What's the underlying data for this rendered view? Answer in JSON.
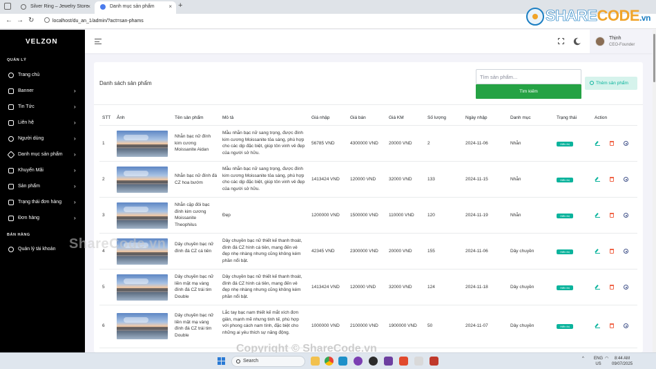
{
  "browser": {
    "tabs": [
      {
        "title": "Silver Ring – Jewelry Store"
      },
      {
        "title": "Danh mục sản phẩm"
      }
    ],
    "url": "localhost/du_an_1/admin/?act=san-phams"
  },
  "watermark": {
    "logo_share": "SHARE",
    "logo_code": "CODE",
    "logo_vn": ".vn",
    "mid_text": "ShareCode.vn",
    "bottom_text": "Copyright © ShareCode.vn"
  },
  "sidebar": {
    "brand": "VELZON",
    "section_admin": "QUẢN LÝ",
    "section_sales": "BÁN HÀNG",
    "items": [
      {
        "label": "Trang chủ",
        "icon": "dashboard-icon",
        "arrow": ""
      },
      {
        "label": "Banner",
        "icon": "image-icon",
        "arrow": "›"
      },
      {
        "label": "Tin Tức",
        "icon": "news-icon",
        "arrow": "›"
      },
      {
        "label": "Liên hệ",
        "icon": "contact-icon",
        "arrow": "›"
      },
      {
        "label": "Người dùng",
        "icon": "user-icon",
        "arrow": "›"
      },
      {
        "label": "Danh mục sản phẩm",
        "icon": "category-icon",
        "arrow": "›"
      },
      {
        "label": "Khuyến Mãi",
        "icon": "promo-icon",
        "arrow": "›"
      },
      {
        "label": "Sản phẩm",
        "icon": "product-icon",
        "arrow": "›"
      },
      {
        "label": "Trạng thái đơn hàng",
        "icon": "cart-icon",
        "arrow": "›"
      },
      {
        "label": "Đơn hàng",
        "icon": "bag-icon",
        "arrow": "›"
      }
    ],
    "sales_items": [
      {
        "label": "Quản lý tài khoản",
        "icon": "account-icon"
      }
    ]
  },
  "topbar": {
    "user_name": "Thịnh",
    "user_role": "CEO-Founder"
  },
  "card": {
    "title": "Danh sách sản phẩm",
    "search_placeholder": "Tìm sản phẩm...",
    "search_button": "Tìm kiếm",
    "add_button": "Thêm sản phẩm"
  },
  "table": {
    "headers": [
      "STT",
      "Ảnh",
      "Tên sản phẩm",
      "Mô tả",
      "Giá nhập",
      "Giá bán",
      "Giá KM",
      "Số lượng",
      "Ngày nhập",
      "Danh mục",
      "Trạng thái",
      "Action"
    ],
    "rows": [
      {
        "stt": "1",
        "name": "Nhẫn bạc nữ đính kim cương Moissanite Aidan",
        "desc": "Mẫu nhẫn bạc nữ sang trọng, được đính kim cương Moissanite tỏa sáng, phù hợp cho các dịp đặc biệt, giúp tôn vinh vẻ đẹp của người sở hữu.",
        "import_price": "56785 VND",
        "sale_price": "4300000 VND",
        "promo_price": "20000 VND",
        "qty": "2",
        "date": "2024-11-06",
        "category": "Nhẫn",
        "status": "Hiển thị"
      },
      {
        "stt": "2",
        "name": "Nhẫn bạc nữ đính đá CZ hoa bướm",
        "desc": "Mẫu nhẫn bạc nữ sang trọng, được đính kim cương Moissanite tỏa sáng, phù hợp cho các dịp đặc biệt, giúp tôn vinh vẻ đẹp của người sở hữu.",
        "import_price": "1413424 VND",
        "sale_price": "120000 VND",
        "promo_price": "32000 VND",
        "qty": "133",
        "date": "2024-11-15",
        "category": "Nhẫn",
        "status": "Hiển thị"
      },
      {
        "stt": "3",
        "name": "Nhẫn cặp đôi bạc đính kim cương Moissanite Theophilus",
        "desc": "Đẹp",
        "import_price": "1200000 VND",
        "sale_price": "1500000 VND",
        "promo_price": "110000 VND",
        "qty": "120",
        "date": "2024-11-19",
        "category": "Nhẫn",
        "status": "Hiển thị"
      },
      {
        "stt": "4",
        "name": "Dây chuyền bạc nữ đính đá CZ cá tiên",
        "desc": "Dây chuyền bạc nữ thiết kế thanh thoát, đính đá CZ hình cá tiên, mang đến vẻ đẹp nhẹ nhàng nhưng cũng không kém phần nổi bật.",
        "import_price": "42345 VND",
        "sale_price": "2300000 VND",
        "promo_price": "20000 VND",
        "qty": "155",
        "date": "2024-11-06",
        "category": "Dây chuyền",
        "status": "Hiển thị"
      },
      {
        "stt": "5",
        "name": "Dây chuyền bạc nữ liền mặt mạ vàng đính đá CZ trái tim Double",
        "desc": "Dây chuyền bạc nữ thiết kế thanh thoát, đính đá CZ hình cá tiên, mang đến vẻ đẹp nhẹ nhàng nhưng cũng không kém phần nổi bật.",
        "import_price": "1413424 VND",
        "sale_price": "120000 VND",
        "promo_price": "32000 VND",
        "qty": "124",
        "date": "2024-11-18",
        "category": "Dây chuyền",
        "status": "Hiển thị"
      },
      {
        "stt": "6",
        "name": "Dây chuyền bạc nữ liền mặt mạ vàng đính đá CZ trái tim Double",
        "desc": "Lắc tay bạc nam thiết kế mắt xích đơn giản, mạnh mẽ nhưng tinh tế, phù hợp với phong cách nam tính, đặc biệt cho những ai yêu thích sự năng động.",
        "import_price": "1000000 VND",
        "sale_price": "2100000 VND",
        "promo_price": "1900000 VND",
        "qty": "50",
        "date": "2024-11-07",
        "category": "Dây chuyền",
        "status": "Hiển thị"
      }
    ]
  },
  "taskbar": {
    "search_label": "Search",
    "lang_top": "ENG",
    "lang_bottom": "US",
    "time": "8:44 AM",
    "date": "09/07/2025"
  },
  "colors": {
    "sidebar_bg": "#000000",
    "primary_green": "#25a244",
    "success_teal": "#0ab39c",
    "danger": "#f06548",
    "info": "#405189"
  }
}
